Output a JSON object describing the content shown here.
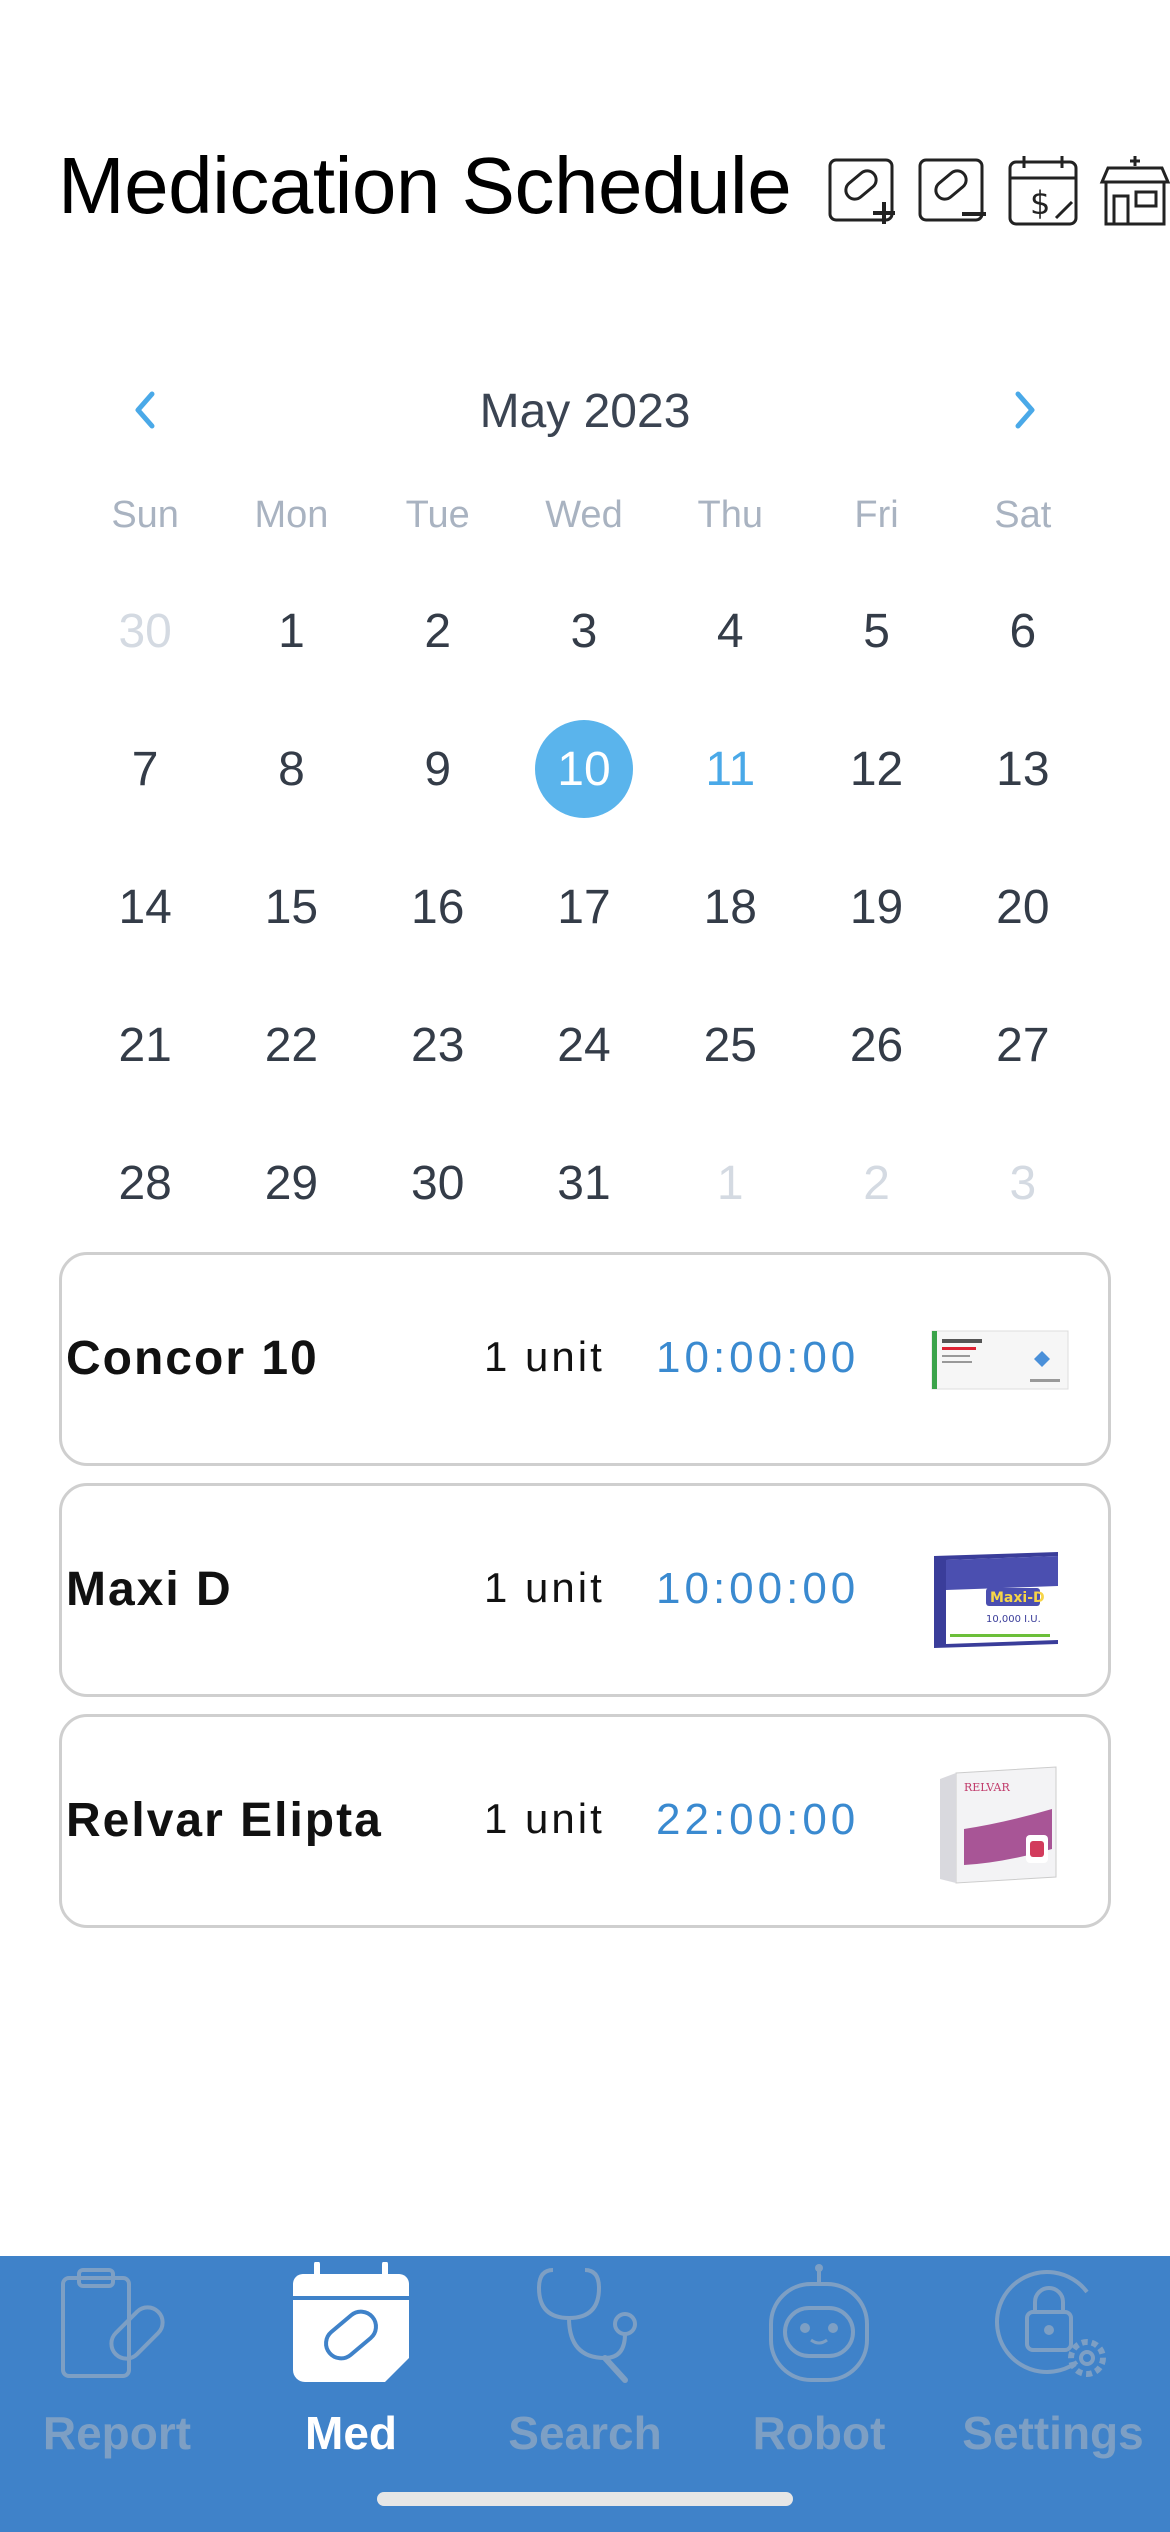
{
  "header": {
    "title": "Medication Schedule",
    "icons": [
      "add-pill-icon",
      "remove-pill-icon",
      "calendar-price-icon",
      "pharmacy-icon"
    ]
  },
  "calendar": {
    "month_label": "May 2023",
    "weekdays": [
      "Sun",
      "Mon",
      "Tue",
      "Wed",
      "Thu",
      "Fri",
      "Sat"
    ],
    "weeks": [
      [
        {
          "d": "30",
          "s": "other"
        },
        {
          "d": "1"
        },
        {
          "d": "2"
        },
        {
          "d": "3"
        },
        {
          "d": "4"
        },
        {
          "d": "5"
        },
        {
          "d": "6"
        }
      ],
      [
        {
          "d": "7"
        },
        {
          "d": "8"
        },
        {
          "d": "9"
        },
        {
          "d": "10",
          "s": "selected"
        },
        {
          "d": "11",
          "s": "today"
        },
        {
          "d": "12"
        },
        {
          "d": "13"
        }
      ],
      [
        {
          "d": "14"
        },
        {
          "d": "15"
        },
        {
          "d": "16"
        },
        {
          "d": "17"
        },
        {
          "d": "18"
        },
        {
          "d": "19"
        },
        {
          "d": "20"
        }
      ],
      [
        {
          "d": "21"
        },
        {
          "d": "22"
        },
        {
          "d": "23"
        },
        {
          "d": "24"
        },
        {
          "d": "25"
        },
        {
          "d": "26"
        },
        {
          "d": "27"
        }
      ],
      [
        {
          "d": "28"
        },
        {
          "d": "29"
        },
        {
          "d": "30"
        },
        {
          "d": "31"
        },
        {
          "d": "1",
          "s": "other"
        },
        {
          "d": "2",
          "s": "other"
        },
        {
          "d": "3",
          "s": "other"
        }
      ]
    ],
    "selected_color": "#5ab4ec",
    "today_color": "#4aa9e8"
  },
  "medications": [
    {
      "name": "Concor 10",
      "dose": "1 unit",
      "time": "10:00:00",
      "image": "concor-box-image"
    },
    {
      "name": "Maxi D",
      "dose": "1 unit",
      "time": "10:00:00",
      "image": "maxi-d-box-image"
    },
    {
      "name": "Relvar Elipta",
      "dose": "1 unit",
      "time": "22:00:00",
      "image": "relvar-box-image"
    }
  ],
  "tabbar": {
    "background": "#3f82c9",
    "tabs": [
      {
        "label": "Report",
        "icon": "clipboard-icon",
        "active": false
      },
      {
        "label": "Med",
        "icon": "calendar-pill-icon",
        "active": true
      },
      {
        "label": "Search",
        "icon": "stethoscope-icon",
        "active": false
      },
      {
        "label": "Robot",
        "icon": "robot-icon",
        "active": false
      },
      {
        "label": "Settings",
        "icon": "lock-gear-icon",
        "active": false
      }
    ]
  }
}
